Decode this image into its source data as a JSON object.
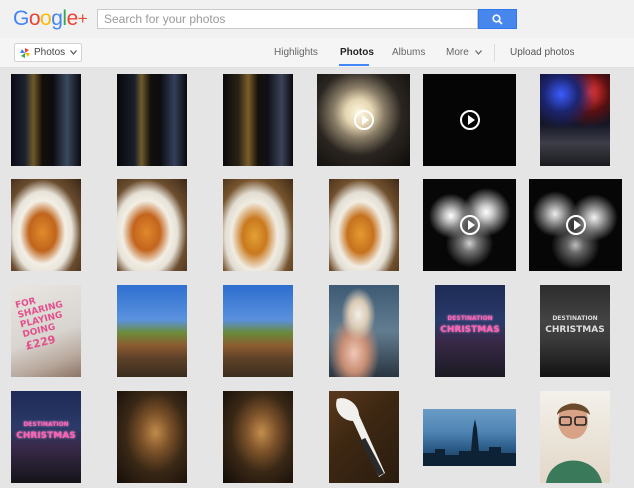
{
  "header": {
    "logo_text": "Google",
    "logo_plus": "+",
    "search_placeholder": "Search for your photos"
  },
  "subnav": {
    "photos_dropdown": "Photos",
    "tabs": [
      "Highlights",
      "Photos",
      "Albums",
      "More"
    ],
    "active_tab": "Photos",
    "upload": "Upload photos"
  },
  "photos": {
    "signs": {
      "destination": "DESTINATION",
      "christmas": "CHRISTMAS"
    },
    "newspaper": [
      "FOR",
      "SHARING",
      "PLAYING",
      "DOING",
      "£229"
    ]
  },
  "colors": {
    "accent": "#4285f4",
    "search_button": "#4787ed",
    "background": "#e5e5e5"
  }
}
